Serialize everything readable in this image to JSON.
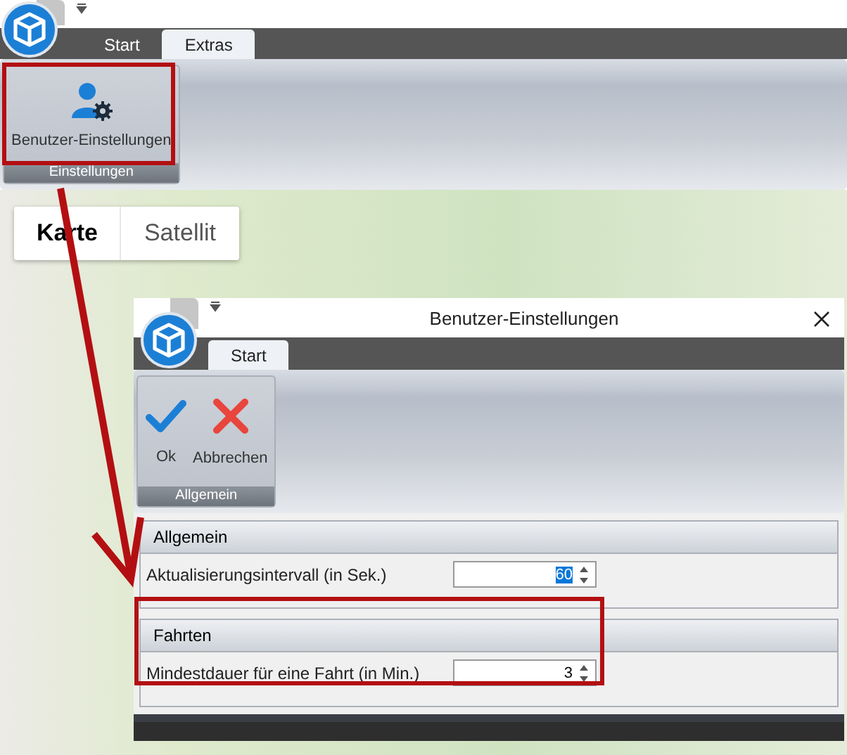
{
  "app": {
    "tabs": [
      {
        "label": "Start",
        "selected": false
      },
      {
        "label": "Extras",
        "selected": true
      }
    ],
    "ribbon_groups": [
      {
        "label": "Einstellungen",
        "buttons": [
          {
            "label": "Benutzer-Einstellungen",
            "kind": "user-settings"
          }
        ]
      }
    ]
  },
  "map": {
    "view_toggle": [
      {
        "label": "Karte",
        "selected": true
      },
      {
        "label": "Satellit",
        "selected": false
      }
    ]
  },
  "dialog": {
    "title": "Benutzer-Einstellungen",
    "tabs": [
      {
        "label": "Start",
        "selected": true
      }
    ],
    "ribbon_groups": [
      {
        "label": "Allgemein",
        "buttons": [
          {
            "label": "Ok",
            "kind": "ok"
          },
          {
            "label": "Abbrechen",
            "kind": "cancel"
          }
        ]
      }
    ],
    "sections": [
      {
        "title": "Allgemein",
        "fields": [
          {
            "label": "Aktualisierungsintervall (in Sek.)",
            "value": "60",
            "highlighted": true
          }
        ]
      },
      {
        "title": "Fahrten",
        "fields": [
          {
            "label": "Mindestdauer für eine Fahrt (in Min.)",
            "value": "3",
            "highlighted": false
          }
        ]
      }
    ]
  }
}
